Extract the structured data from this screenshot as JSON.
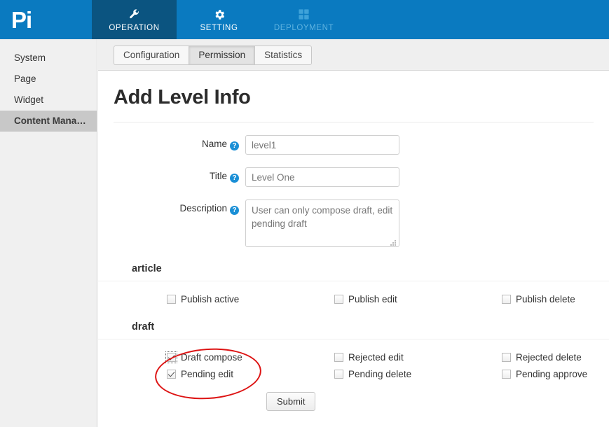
{
  "topbar": {
    "logo_text": "Pi",
    "items": [
      {
        "label": "OPERATION",
        "icon": "wrench-icon",
        "state": "active"
      },
      {
        "label": "SETTING",
        "icon": "gear-icon",
        "state": "normal"
      },
      {
        "label": "DEPLOYMENT",
        "icon": "grid-icon",
        "state": "dimmed"
      }
    ],
    "bg_color": "#0a7ac0",
    "active_bg_color": "#0b5480"
  },
  "sidebar": {
    "items": [
      {
        "label": "System",
        "active": false
      },
      {
        "label": "Page",
        "active": false
      },
      {
        "label": "Widget",
        "active": false
      },
      {
        "label": "Content Mana…",
        "active": true
      }
    ],
    "active_bg_color": "#c8c8c8"
  },
  "tabs": [
    {
      "label": "Configuration",
      "active": false
    },
    {
      "label": "Permission",
      "active": true
    },
    {
      "label": "Statistics",
      "active": false
    }
  ],
  "page": {
    "title": "Add Level Info"
  },
  "form": {
    "help_glyph": "?",
    "fields": [
      {
        "label": "Name",
        "name": "name-field",
        "value": "level1",
        "placeholder": "",
        "type": "text"
      },
      {
        "label": "Title",
        "name": "title-field",
        "value": "Level One",
        "placeholder": "",
        "type": "text"
      },
      {
        "label": "Description",
        "name": "description-field",
        "value": "User can only compose draft, edit pending draft",
        "placeholder": "",
        "type": "textarea"
      }
    ]
  },
  "permissions": [
    {
      "group": "article",
      "columns": [
        [
          {
            "label": "Publish active",
            "checked": false,
            "focused": false
          }
        ],
        [
          {
            "label": "Publish edit",
            "checked": false,
            "focused": false
          }
        ],
        [
          {
            "label": "Publish delete",
            "checked": false,
            "focused": false
          }
        ]
      ]
    },
    {
      "group": "draft",
      "columns": [
        [
          {
            "label": "Draft compose",
            "checked": true,
            "focused": true
          },
          {
            "label": "Pending edit",
            "checked": true,
            "focused": false
          }
        ],
        [
          {
            "label": "Rejected edit",
            "checked": false,
            "focused": false
          },
          {
            "label": "Pending delete",
            "checked": false,
            "focused": false
          }
        ],
        [
          {
            "label": "Rejected delete",
            "checked": false,
            "focused": false
          },
          {
            "label": "Pending approve",
            "checked": false,
            "focused": false
          }
        ]
      ]
    }
  ],
  "submit": {
    "label": "Submit"
  },
  "annotation": {
    "shape": "ellipse",
    "color": "#dd1414",
    "encircles": [
      "Draft compose",
      "Pending edit"
    ]
  }
}
